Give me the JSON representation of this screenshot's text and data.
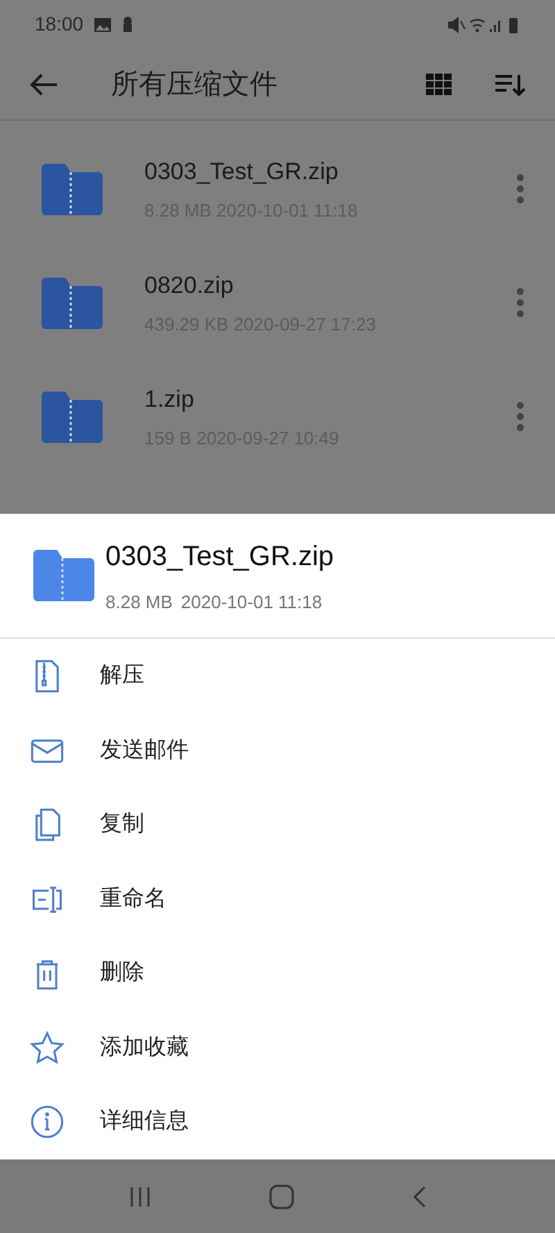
{
  "status_bar": {
    "time": "18:00"
  },
  "app_bar": {
    "title": "所有压缩文件"
  },
  "files": [
    {
      "name": "0303_Test_GR.zip",
      "meta": "8.28 MB 2020-10-01 11:18"
    },
    {
      "name": "0820.zip",
      "meta": "439.29 KB 2020-09-27 17:23"
    },
    {
      "name": "1.zip",
      "meta": "159 B 2020-09-27 10:49"
    }
  ],
  "sheet": {
    "file_name": "0303_Test_GR.zip",
    "size": "8.28 MB",
    "date": "2020-10-01 11:18",
    "actions": [
      {
        "kind": "extract",
        "label": "解压"
      },
      {
        "kind": "email",
        "label": "发送邮件"
      },
      {
        "kind": "copy",
        "label": "复制"
      },
      {
        "kind": "rename",
        "label": "重命名"
      },
      {
        "kind": "delete",
        "label": "删除"
      },
      {
        "kind": "favorite",
        "label": "添加收藏"
      },
      {
        "kind": "info",
        "label": "详细信息"
      }
    ]
  }
}
